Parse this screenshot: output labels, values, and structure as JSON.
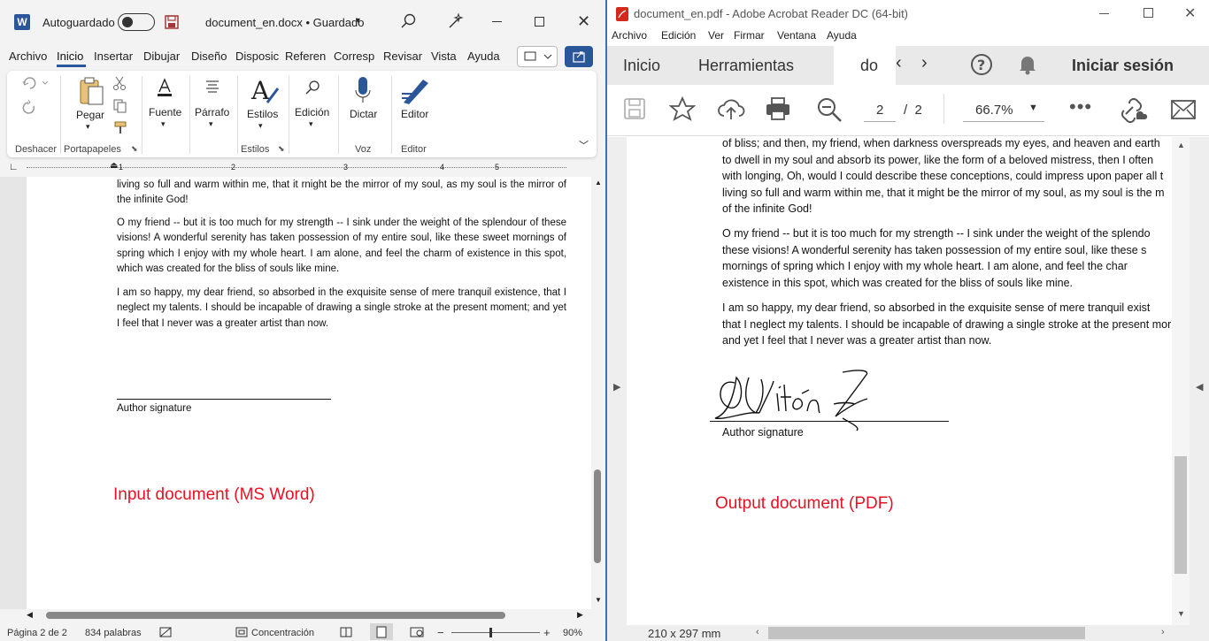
{
  "word": {
    "autosave_label": "Autoguardado",
    "doc_title": "document_en.docx • Guardado",
    "tabs": [
      "Archivo",
      "Inicio",
      "Insertar",
      "Dibujar",
      "Diseño",
      "Disposic",
      "Referen",
      "Corresp",
      "Revisar",
      "Vista",
      "Ayuda"
    ],
    "ribbon": {
      "pegar": "Pegar",
      "fuente": "Fuente",
      "parrafo": "Párrafo",
      "estilos": "Estilos",
      "edicion": "Edición",
      "dictar": "Dictar",
      "editor": "Editor"
    },
    "groups": {
      "deshacer": "Deshacer",
      "portapapeles": "Portapapeles",
      "estilos": "Estilos",
      "voz": "Voz",
      "editor": "Editor"
    },
    "ruler": [
      "1",
      "2",
      "3",
      "4",
      "5"
    ],
    "paragraphs": [
      "living so full and warm within me, that it rnight be the mirror of my soul, as my soul is the mirror of the infinite God!",
      "O my friend -- but it is too much for my strength -- I sink under the weight of the splendour of these visions! A wonderful serenity has taken possession of my entire soul, like these sweet mornings of spring which I enjoy with my whole heart. I am alone, and feel the charm of existence in this spot, which was created for the bliss of souls like mine.",
      "I am so happy, my dear friend, so absorbed in the exquisite sense of mere tranquil existence, that I neglect my talents. I should be incapable of drawing a single stroke at the present moment; and yet I feel that I never was a greater artist than now."
    ],
    "signature_label": "Author signature",
    "annotation": "Input document (MS Word)",
    "status": {
      "page": "Página 2 de 2",
      "words": "834 palabras",
      "focus": "Concentración",
      "zoom": "90%"
    }
  },
  "pdf": {
    "title": "document_en.pdf - Adobe Acrobat Reader DC (64-bit)",
    "menu": [
      "Archivo",
      "Edición",
      "Ver",
      "Firmar",
      "Ventana",
      "Ayuda"
    ],
    "tabs": {
      "inicio": "Inicio",
      "herramientas": "Herramientas",
      "doc": "do"
    },
    "signin": "Iniciar sesión",
    "page_current": "2",
    "page_total": "/  2",
    "zoom": "66.7%",
    "lines_p1": [
      "of bliss; and then, my friend, when darkness overspreads my eyes, and heaven and earth",
      "to dwell in my soul and absorb its power, like the form of a beloved mistress, then I often",
      "with longing, Oh, would I could describe these conceptions, could impress upon paper all t",
      "living so full and warm within me, that it might be the mirror of my soul, as my soul is the m",
      "of the infinite God!"
    ],
    "lines_p2": [
      "O my friend -- but it is too much for my strength -- I sink under the weight of the splendo",
      "these visions! A wonderful serenity has taken possession of my entire soul, like these s",
      "mornings of spring which I enjoy with my whole heart. I am alone, and feel the char",
      "existence in this spot, which was created for the bliss of souls like mine."
    ],
    "lines_p3": [
      "I am so happy, my dear friend, so absorbed in the exquisite sense of mere tranquil exist",
      "that I neglect my talents. I should be incapable of drawing a single stroke at the present mor",
      "and yet I feel that I never was a greater artist than now."
    ],
    "signature_label": "Author signature",
    "annotation": "Output document (PDF)",
    "page_size": "210 x 297 mm"
  },
  "colors": {
    "word_blue": "#2b579a",
    "annotation_red": "#e81123",
    "acrobat_red": "#d4291f"
  }
}
